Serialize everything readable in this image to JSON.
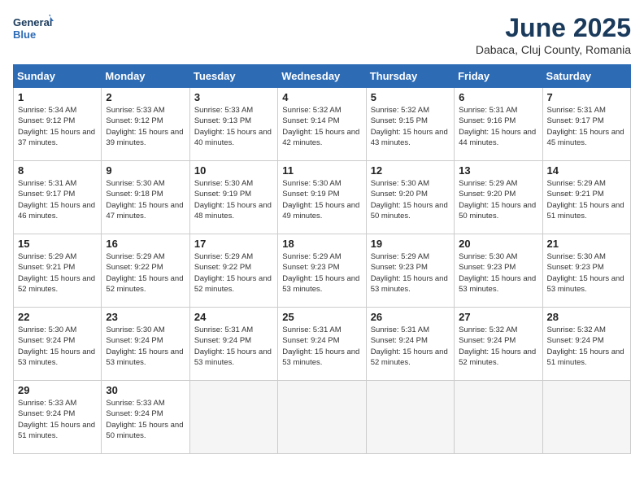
{
  "logo": {
    "line1": "General",
    "line2": "Blue"
  },
  "title": "June 2025",
  "location": "Dabaca, Cluj County, Romania",
  "days_header": [
    "Sunday",
    "Monday",
    "Tuesday",
    "Wednesday",
    "Thursday",
    "Friday",
    "Saturday"
  ],
  "weeks": [
    [
      {
        "day": "1",
        "sunrise": "5:34 AM",
        "sunset": "9:12 PM",
        "daylight": "15 hours and 37 minutes."
      },
      {
        "day": "2",
        "sunrise": "5:33 AM",
        "sunset": "9:12 PM",
        "daylight": "15 hours and 39 minutes."
      },
      {
        "day": "3",
        "sunrise": "5:33 AM",
        "sunset": "9:13 PM",
        "daylight": "15 hours and 40 minutes."
      },
      {
        "day": "4",
        "sunrise": "5:32 AM",
        "sunset": "9:14 PM",
        "daylight": "15 hours and 42 minutes."
      },
      {
        "day": "5",
        "sunrise": "5:32 AM",
        "sunset": "9:15 PM",
        "daylight": "15 hours and 43 minutes."
      },
      {
        "day": "6",
        "sunrise": "5:31 AM",
        "sunset": "9:16 PM",
        "daylight": "15 hours and 44 minutes."
      },
      {
        "day": "7",
        "sunrise": "5:31 AM",
        "sunset": "9:17 PM",
        "daylight": "15 hours and 45 minutes."
      }
    ],
    [
      {
        "day": "8",
        "sunrise": "5:31 AM",
        "sunset": "9:17 PM",
        "daylight": "15 hours and 46 minutes."
      },
      {
        "day": "9",
        "sunrise": "5:30 AM",
        "sunset": "9:18 PM",
        "daylight": "15 hours and 47 minutes."
      },
      {
        "day": "10",
        "sunrise": "5:30 AM",
        "sunset": "9:19 PM",
        "daylight": "15 hours and 48 minutes."
      },
      {
        "day": "11",
        "sunrise": "5:30 AM",
        "sunset": "9:19 PM",
        "daylight": "15 hours and 49 minutes."
      },
      {
        "day": "12",
        "sunrise": "5:30 AM",
        "sunset": "9:20 PM",
        "daylight": "15 hours and 50 minutes."
      },
      {
        "day": "13",
        "sunrise": "5:29 AM",
        "sunset": "9:20 PM",
        "daylight": "15 hours and 50 minutes."
      },
      {
        "day": "14",
        "sunrise": "5:29 AM",
        "sunset": "9:21 PM",
        "daylight": "15 hours and 51 minutes."
      }
    ],
    [
      {
        "day": "15",
        "sunrise": "5:29 AM",
        "sunset": "9:21 PM",
        "daylight": "15 hours and 52 minutes."
      },
      {
        "day": "16",
        "sunrise": "5:29 AM",
        "sunset": "9:22 PM",
        "daylight": "15 hours and 52 minutes."
      },
      {
        "day": "17",
        "sunrise": "5:29 AM",
        "sunset": "9:22 PM",
        "daylight": "15 hours and 52 minutes."
      },
      {
        "day": "18",
        "sunrise": "5:29 AM",
        "sunset": "9:23 PM",
        "daylight": "15 hours and 53 minutes."
      },
      {
        "day": "19",
        "sunrise": "5:29 AM",
        "sunset": "9:23 PM",
        "daylight": "15 hours and 53 minutes."
      },
      {
        "day": "20",
        "sunrise": "5:30 AM",
        "sunset": "9:23 PM",
        "daylight": "15 hours and 53 minutes."
      },
      {
        "day": "21",
        "sunrise": "5:30 AM",
        "sunset": "9:23 PM",
        "daylight": "15 hours and 53 minutes."
      }
    ],
    [
      {
        "day": "22",
        "sunrise": "5:30 AM",
        "sunset": "9:24 PM",
        "daylight": "15 hours and 53 minutes."
      },
      {
        "day": "23",
        "sunrise": "5:30 AM",
        "sunset": "9:24 PM",
        "daylight": "15 hours and 53 minutes."
      },
      {
        "day": "24",
        "sunrise": "5:31 AM",
        "sunset": "9:24 PM",
        "daylight": "15 hours and 53 minutes."
      },
      {
        "day": "25",
        "sunrise": "5:31 AM",
        "sunset": "9:24 PM",
        "daylight": "15 hours and 53 minutes."
      },
      {
        "day": "26",
        "sunrise": "5:31 AM",
        "sunset": "9:24 PM",
        "daylight": "15 hours and 52 minutes."
      },
      {
        "day": "27",
        "sunrise": "5:32 AM",
        "sunset": "9:24 PM",
        "daylight": "15 hours and 52 minutes."
      },
      {
        "day": "28",
        "sunrise": "5:32 AM",
        "sunset": "9:24 PM",
        "daylight": "15 hours and 51 minutes."
      }
    ],
    [
      {
        "day": "29",
        "sunrise": "5:33 AM",
        "sunset": "9:24 PM",
        "daylight": "15 hours and 51 minutes."
      },
      {
        "day": "30",
        "sunrise": "5:33 AM",
        "sunset": "9:24 PM",
        "daylight": "15 hours and 50 minutes."
      },
      null,
      null,
      null,
      null,
      null
    ]
  ]
}
